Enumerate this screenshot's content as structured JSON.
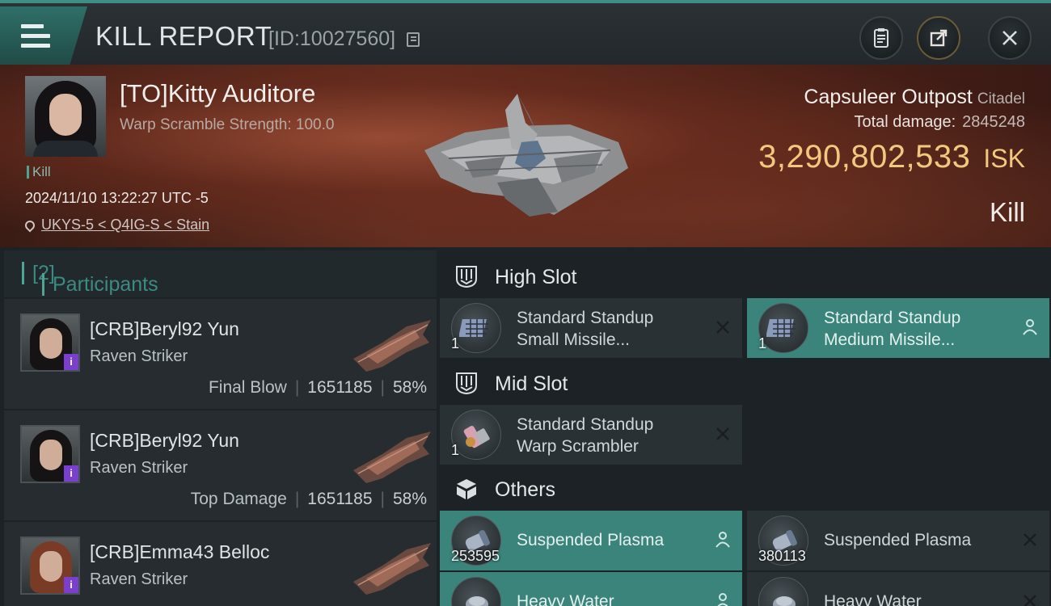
{
  "header": {
    "title": "KILL REPORT",
    "report_id": "[ID:10027560]"
  },
  "victim": {
    "name": "[TO]Kitty Auditore",
    "subtitle": "Warp Scramble Strength: 100.0",
    "kill_label": "Kill",
    "datetime": "2024/11/10 13:22:27 UTC -5",
    "location": "UKYS-5 < Q4IG-S < Stain",
    "ship_name": "Capsuleer Outpost",
    "ship_class": "Citadel",
    "total_damage_label": "Total damage:",
    "total_damage": "2845248",
    "isk_value": "3,290,802,533",
    "isk_unit": "ISK",
    "result": "Kill"
  },
  "participants": {
    "title": "Participants",
    "count": "[2]",
    "items": [
      {
        "name": "[CRB]Beryl92 Yun",
        "ship": "Raven Striker",
        "label": "Final Blow",
        "damage": "1651185",
        "percent": "58%"
      },
      {
        "name": "[CRB]Beryl92 Yun",
        "ship": "Raven Striker",
        "label": "Top Damage",
        "damage": "1651185",
        "percent": "58%"
      },
      {
        "name": "[CRB]Emma43 Belloc",
        "ship": "Raven Striker"
      }
    ]
  },
  "fitting": {
    "high_slot": {
      "label": "High Slot",
      "items": [
        {
          "line1": "Standard Standup",
          "line2": "Small Missile...",
          "qty": "1",
          "icon": "missile-launcher-icon"
        },
        {
          "line1": "Standard Standup",
          "line2": "Medium Missile...",
          "qty": "1",
          "icon": "missile-launcher-icon"
        }
      ]
    },
    "mid_slot": {
      "label": "Mid Slot",
      "items": [
        {
          "line1": "Standard Standup",
          "line2": "Warp Scrambler",
          "qty": "1",
          "icon": "warp-scrambler-icon"
        }
      ]
    },
    "others": {
      "label": "Others",
      "items": [
        {
          "name": "Suspended Plasma",
          "qty": "253595"
        },
        {
          "name": "Suspended Plasma",
          "qty": "380113"
        },
        {
          "name": "Heavy Water"
        },
        {
          "name": "Heavy Water"
        }
      ]
    }
  }
}
